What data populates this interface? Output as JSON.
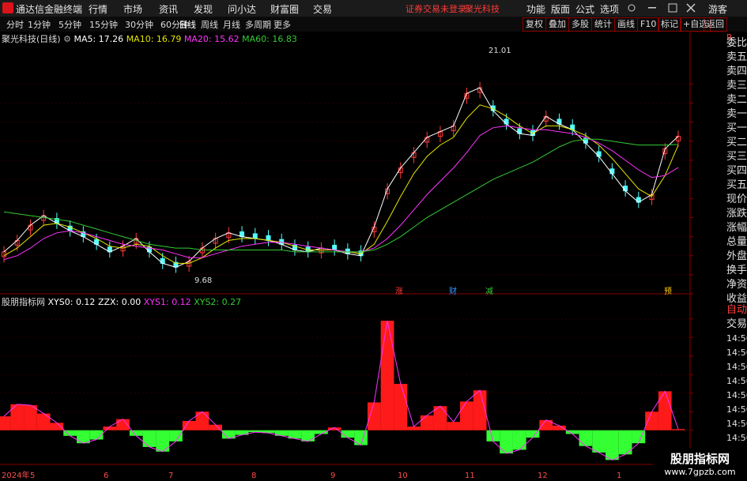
{
  "titlebar": {
    "app_name": "通达信金融终端",
    "menus": [
      "行情",
      "市场",
      "资讯",
      "发现",
      "问小达",
      "财富圈",
      "交易"
    ],
    "notice": "证券交易未登录",
    "stock_name": "聚光科技",
    "right_menus": [
      "功能",
      "版面",
      "公式",
      "选项"
    ],
    "guest": "游客"
  },
  "toolbar": {
    "periods": [
      "分时",
      "1分钟",
      "5分钟",
      "15分钟",
      "30分钟",
      "60分钟",
      "日线",
      "周线",
      "月线",
      "多周期",
      "更多"
    ],
    "active_period": "日线",
    "right_buttons": [
      "复权",
      "叠加",
      "多股",
      "统计",
      "画线",
      "F10",
      "标记",
      "+自选",
      "返回"
    ]
  },
  "main_chart": {
    "title": "聚光科技(日线)",
    "ma": [
      {
        "label": "MA5: 17.26",
        "color": "#ffffff"
      },
      {
        "label": "MA10: 16.79",
        "color": "#e6e600"
      },
      {
        "label": "MA20: 15.62",
        "color": "#ff33ff"
      },
      {
        "label": "MA60: 16.83",
        "color": "#33cc33"
      }
    ],
    "high_label": "21.01",
    "low_label": "9.68",
    "markers": [
      {
        "text": "涨",
        "color": "#ff3b3b"
      },
      {
        "text": "财",
        "color": "#3399ff"
      },
      {
        "text": "减",
        "color": "#33cc33"
      },
      {
        "text": "预",
        "color": "#ffcc00"
      }
    ]
  },
  "sub_chart": {
    "title": "股朋指标网",
    "values": [
      {
        "label": "XYS0: 0.12",
        "color": "#ffffff"
      },
      {
        "label": "ZZX: 0.00",
        "color": "#ffffff"
      },
      {
        "label": "XYS1: 0.12",
        "color": "#ff33ff"
      },
      {
        "label": "XYS2: 0.27",
        "color": "#33cc33"
      }
    ]
  },
  "x_axis": {
    "labels": [
      "2024年",
      "5",
      "6",
      "7",
      "8",
      "9",
      "10",
      "11",
      "12",
      "1"
    ]
  },
  "right_panel": {
    "items": [
      "委比",
      "卖五",
      "卖四",
      "卖三",
      "卖二",
      "卖一",
      "买一",
      "买二",
      "买三",
      "买四",
      "买五",
      "现价",
      "涨跌",
      "涨幅",
      "总量",
      "外盘",
      "换手",
      "净资",
      "收益"
    ],
    "lower": [
      "自动",
      "交易"
    ],
    "times": [
      "14:56",
      "14:56",
      "14:56",
      "14:56",
      "14:56",
      "14:56",
      "14:56",
      "14:56"
    ],
    "top_char": "R"
  },
  "watermark": {
    "line1": "股朋指标网",
    "line2": "www.7gpzb.com"
  },
  "chart_data": [
    {
      "type": "line",
      "title": "聚光科技(日线)",
      "ylim": [
        9.5,
        21.5
      ],
      "yticks": [
        10.0,
        11.0,
        12.0,
        13.0,
        14.0,
        15.0,
        16.0,
        17.0,
        18.0,
        19.0,
        20.0
      ],
      "series": [
        {
          "name": "MA5",
          "color": "#ffffff",
          "values": [
            11.2,
            11.8,
            12.6,
            13.1,
            12.7,
            12.3,
            12.0,
            11.6,
            11.2,
            11.5,
            11.9,
            11.2,
            10.6,
            10.4,
            10.7,
            11.4,
            11.9,
            12.2,
            12.0,
            11.9,
            11.8,
            11.6,
            11.3,
            11.2,
            11.4,
            11.3,
            11.1,
            11.0,
            12.5,
            14.5,
            15.6,
            16.4,
            17.2,
            17.5,
            17.8,
            19.5,
            19.8,
            18.6,
            17.9,
            17.4,
            17.3,
            18.3,
            17.9,
            17.6,
            16.9,
            16.2,
            15.3,
            14.4,
            13.8,
            14.2,
            16.6,
            17.26
          ]
        },
        {
          "name": "MA10",
          "color": "#e6e600",
          "values": [
            11.0,
            11.4,
            12.0,
            12.6,
            12.7,
            12.5,
            12.2,
            11.9,
            11.5,
            11.4,
            11.6,
            11.5,
            11.0,
            10.6,
            10.6,
            10.9,
            11.4,
            11.8,
            11.9,
            11.9,
            11.8,
            11.7,
            11.5,
            11.3,
            11.3,
            11.3,
            11.2,
            11.1,
            11.6,
            12.8,
            14.1,
            15.3,
            16.2,
            16.8,
            17.2,
            18.2,
            18.9,
            18.7,
            18.3,
            17.8,
            17.4,
            17.8,
            17.8,
            17.6,
            17.3,
            16.8,
            16.1,
            15.3,
            14.5,
            14.1,
            15.2,
            16.79
          ]
        },
        {
          "name": "MA20",
          "color": "#ff33ff",
          "values": [
            10.8,
            11.0,
            11.4,
            11.9,
            12.2,
            12.3,
            12.2,
            12.0,
            11.8,
            11.6,
            11.5,
            11.4,
            11.3,
            11.1,
            10.9,
            10.9,
            11.1,
            11.3,
            11.5,
            11.6,
            11.7,
            11.7,
            11.6,
            11.5,
            11.4,
            11.3,
            11.2,
            11.2,
            11.4,
            11.9,
            12.6,
            13.4,
            14.2,
            14.9,
            15.6,
            16.4,
            17.3,
            17.7,
            17.8,
            17.7,
            17.6,
            17.6,
            17.5,
            17.4,
            17.2,
            16.9,
            16.5,
            16.0,
            15.5,
            15.1,
            15.2,
            15.62
          ]
        },
        {
          "name": "MA60",
          "color": "#33cc33",
          "values": [
            13.3,
            13.2,
            13.1,
            13.0,
            12.9,
            12.8,
            12.6,
            12.4,
            12.2,
            12.0,
            11.8,
            11.6,
            11.5,
            11.4,
            11.4,
            11.3,
            11.3,
            11.3,
            11.3,
            11.3,
            11.3,
            11.3,
            11.2,
            11.2,
            11.2,
            11.2,
            11.2,
            11.2,
            11.3,
            11.6,
            12.0,
            12.5,
            13.0,
            13.4,
            13.8,
            14.2,
            14.6,
            15.0,
            15.3,
            15.6,
            15.9,
            16.3,
            16.7,
            17.0,
            17.1,
            17.1,
            17.0,
            16.9,
            16.8,
            16.8,
            16.8,
            16.83
          ]
        }
      ]
    },
    {
      "type": "bar",
      "title": "股朋指标网",
      "ylim": [
        -3,
        13
      ],
      "yticks": [
        0.0,
        2.0,
        4.0,
        6.0,
        8.0,
        10.0,
        12.0
      ],
      "values": [
        1.5,
        2.8,
        2.7,
        1.8,
        0.8,
        -0.6,
        -1.4,
        -1.0,
        0.4,
        1.2,
        -0.6,
        -1.8,
        -2.3,
        -1.2,
        1.0,
        2.0,
        0.6,
        -0.9,
        -0.5,
        -0.2,
        -0.3,
        -0.6,
        -0.9,
        -1.2,
        -0.4,
        0.3,
        -0.8,
        -1.6,
        3.0,
        11.8,
        5.0,
        0.4,
        1.6,
        2.6,
        0.9,
        3.1,
        4.3,
        -1.2,
        -2.5,
        -2.1,
        -0.8,
        1.1,
        0.5,
        -0.4,
        -1.7,
        -2.4,
        -3.2,
        -2.6,
        -1.4,
        2.0,
        4.2,
        0.12
      ]
    }
  ]
}
